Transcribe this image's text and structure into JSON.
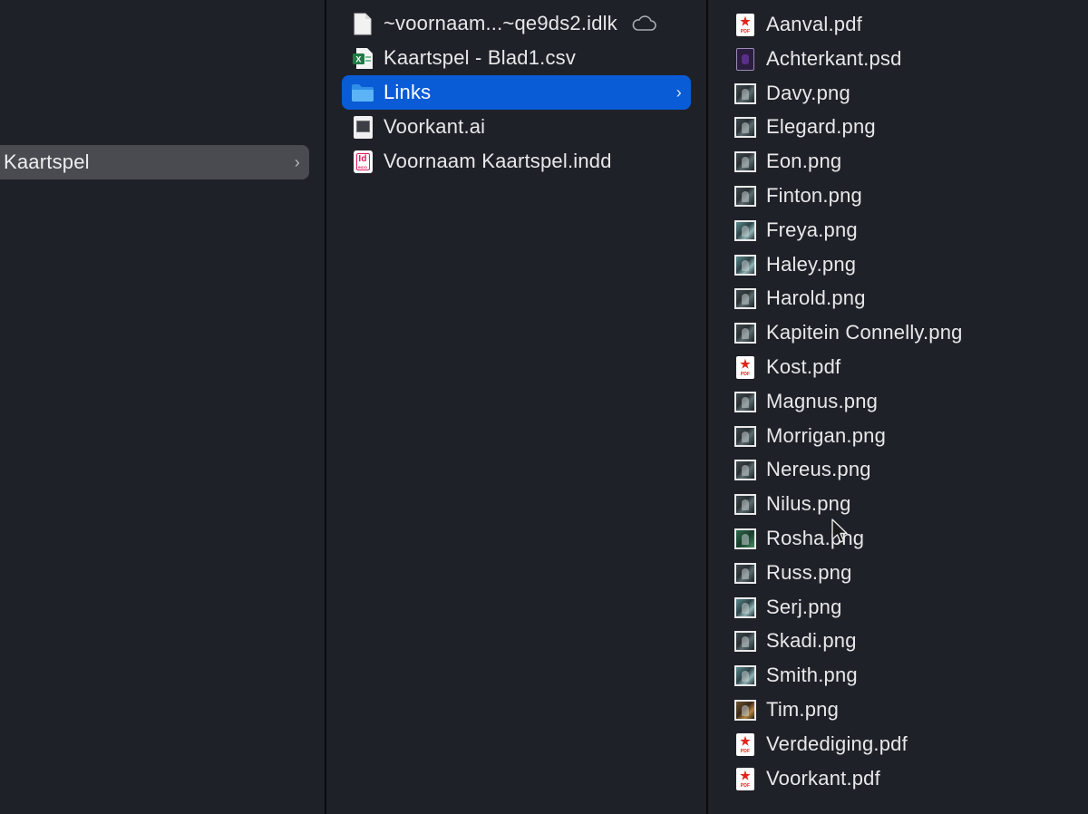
{
  "columns": {
    "parent": {
      "items": [
        {
          "label": "Kaartspel",
          "icon": "folder-icon",
          "selected": true
        }
      ]
    },
    "current": {
      "items": [
        {
          "label": "~voornaam...~qe9ds2.idlk",
          "icon": "document-icon",
          "cloud": true
        },
        {
          "label": "Kaartspel - Blad1.csv",
          "icon": "excel-icon"
        },
        {
          "label": "Links",
          "icon": "folder-icon",
          "selected": true
        },
        {
          "label": "Voorkant.ai",
          "icon": "illustrator-icon"
        },
        {
          "label": "Voornaam Kaartspel.indd",
          "icon": "indesign-icon"
        }
      ]
    },
    "links": {
      "items": [
        {
          "label": "Aanval.pdf",
          "icon": "pdf-icon"
        },
        {
          "label": "Achterkant.psd",
          "icon": "psd-icon"
        },
        {
          "label": "Davy.png",
          "icon": "image-icon"
        },
        {
          "label": "Elegard.png",
          "icon": "image-icon"
        },
        {
          "label": "Eon.png",
          "icon": "image-icon"
        },
        {
          "label": "Finton.png",
          "icon": "image-icon"
        },
        {
          "label": "Freya.png",
          "icon": "image-icon"
        },
        {
          "label": "Haley.png",
          "icon": "image-icon"
        },
        {
          "label": "Harold.png",
          "icon": "image-icon"
        },
        {
          "label": "Kapitein Connelly.png",
          "icon": "image-icon"
        },
        {
          "label": "Kost.pdf",
          "icon": "pdf-icon"
        },
        {
          "label": "Magnus.png",
          "icon": "image-icon"
        },
        {
          "label": "Morrigan.png",
          "icon": "image-icon"
        },
        {
          "label": "Nereus.png",
          "icon": "image-icon"
        },
        {
          "label": "Nilus.png",
          "icon": "image-icon"
        },
        {
          "label": "Rosha.png",
          "icon": "image-icon"
        },
        {
          "label": "Russ.png",
          "icon": "image-icon"
        },
        {
          "label": "Serj.png",
          "icon": "image-icon"
        },
        {
          "label": "Skadi.png",
          "icon": "image-icon"
        },
        {
          "label": "Smith.png",
          "icon": "image-icon"
        },
        {
          "label": "Tim.png",
          "icon": "image-icon"
        },
        {
          "label": "Verdediging.pdf",
          "icon": "pdf-icon"
        },
        {
          "label": "Voorkant.pdf",
          "icon": "pdf-icon"
        }
      ]
    }
  },
  "icon_labels": {
    "pdf": "PDF",
    "indd_top": "Id",
    "indd_bottom": "INDD"
  },
  "colors": {
    "background": "#1f2128",
    "selection_active": "#0a5bd6",
    "selection_inactive": "#4a4b50",
    "folder_blue": "#4aa8f2"
  }
}
